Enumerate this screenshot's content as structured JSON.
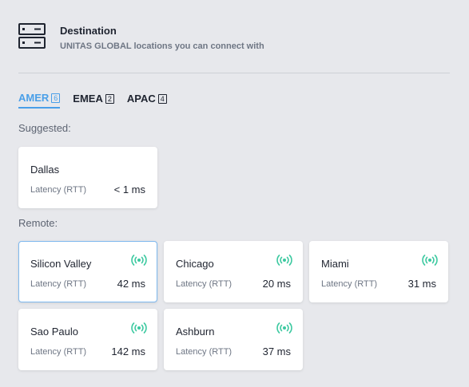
{
  "header": {
    "title": "Destination",
    "subtitle": "UNITAS GLOBAL locations you can connect with",
    "icon": "server-icon"
  },
  "tabs": [
    {
      "label": "AMER",
      "count": "6",
      "active": true
    },
    {
      "label": "EMEA",
      "count": "2",
      "active": false
    },
    {
      "label": "APAC",
      "count": "4",
      "active": false
    }
  ],
  "suggested": {
    "label": "Suggested:",
    "cards": [
      {
        "city": "Dallas",
        "latency_label": "Latency (RTT)",
        "latency": "< 1 ms",
        "signal": false
      }
    ]
  },
  "remote": {
    "label": "Remote:",
    "cards": [
      {
        "city": "Silicon Valley",
        "latency_label": "Latency (RTT)",
        "latency": "42 ms",
        "signal": true,
        "selected": true
      },
      {
        "city": "Chicago",
        "latency_label": "Latency (RTT)",
        "latency": "20 ms",
        "signal": true
      },
      {
        "city": "Miami",
        "latency_label": "Latency (RTT)",
        "latency": "31 ms",
        "signal": true
      },
      {
        "city": "Sao Paulo",
        "latency_label": "Latency (RTT)",
        "latency": "142 ms",
        "signal": true
      },
      {
        "city": "Ashburn",
        "latency_label": "Latency (RTT)",
        "latency": "37 ms",
        "signal": true
      }
    ]
  },
  "colors": {
    "accent": "#4a9fe8",
    "signal": "#3cc9a0",
    "background": "#e7e8ec"
  }
}
